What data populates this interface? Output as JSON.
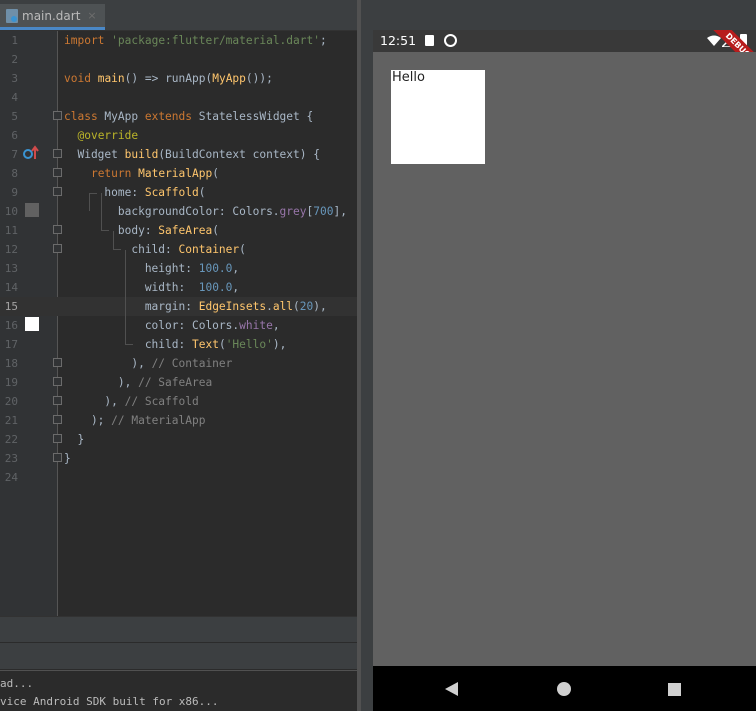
{
  "editor": {
    "tab_label": "main.dart",
    "tab_close": "×",
    "line_numbers": [
      "1",
      "2",
      "3",
      "4",
      "5",
      "6",
      "7",
      "8",
      "9",
      "10",
      "11",
      "12",
      "13",
      "14",
      "15",
      "16",
      "17",
      "18",
      "19",
      "20",
      "21",
      "22",
      "23",
      "24"
    ],
    "current_line": 15,
    "swatches": {
      "grey700": "#616161",
      "white": "#ffffff"
    },
    "console_lines": [
      "ad...",
      "vice Android SDK built for x86..."
    ]
  },
  "emulator": {
    "status_time": "12:51",
    "debug_banner": "DEBUG",
    "app_text": "Hello",
    "screen_color": "#616161"
  },
  "colors": {
    "keyword": "#cc7832",
    "string": "#6a8759",
    "number": "#6897bb",
    "function": "#ffc66d",
    "comment": "#808080"
  }
}
